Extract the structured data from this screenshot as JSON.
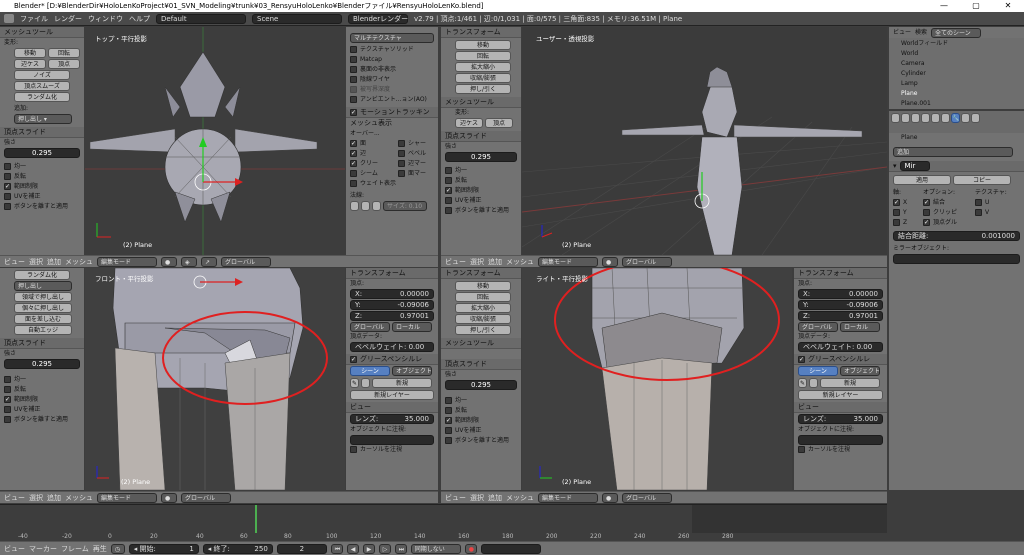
{
  "window": {
    "title": "Blender* [D:¥BlenderDir¥HoloLenKoProject¥01_SVN_Modeling¥trunk¥03_RensyuHoloLenko¥Blenderファイル¥RensyuHoloLenKo.blend]",
    "controls": [
      "—",
      "▢",
      "✕"
    ]
  },
  "infobar": {
    "menus": [
      "ファイル",
      "レンダー",
      "ウィンドウ",
      "ヘルプ"
    ],
    "layout": "Default",
    "scene": "Scene",
    "engine": "Blenderレンダー",
    "stats": "v2.79 | 頂点:1/461 | 辺:0/1,031 | 面:0/575 | 三角面:835 | メモリ:36.51M | Plane"
  },
  "left_tools_top": {
    "section": "メッシュツール",
    "deform": "変形:",
    "buttons": [
      "移動",
      "回転",
      "辺ケス",
      "頂点",
      "ノイズ",
      "頂点スムーズ",
      "ランダム化"
    ],
    "add": "追加:",
    "extrude": "押し出し ▾",
    "slide_header": "頂点スライド",
    "amount_label": "強さ",
    "amount": "0.295",
    "checks": [
      "均一",
      "反転",
      "範囲制限",
      "UVを補正",
      "ボタンを離すと適用"
    ]
  },
  "left_tools_bottom": {
    "buttons": [
      "ランダム化",
      "押し出し",
      "領域で押し出し",
      "個々に押し出し",
      "面を差し込む",
      "自動エッジ"
    ],
    "slide_header": "頂点スライド",
    "amount_label": "強さ",
    "amount": "0.295",
    "checks": [
      "均一",
      "反転",
      "範囲制限",
      "UVを補正",
      "ボタンを離すと適用"
    ]
  },
  "vp_top": {
    "title": "トップ・平行投影",
    "obj": "(2) Plane"
  },
  "vp_user": {
    "title": "ユーザー・透視投影",
    "obj": "(2) Plane"
  },
  "vp_front": {
    "title": "フロント・平行投影",
    "obj": "(2) Plane"
  },
  "vp_right": {
    "title": "ライト・平行投影",
    "obj": "(2) Plane"
  },
  "shading_panel": {
    "matcap_header": "マルチテクスチャ",
    "items": [
      "テクスチャソリッド",
      "Matcap",
      "裏面の非表示",
      "陰線ワイヤ",
      "被写界深度",
      "アンビエント...ョン(AO)"
    ],
    "motion_header": "モーショントラッキン",
    "mesh_display": "メッシュ表示",
    "overlay": "オーバー...",
    "col1": [
      "面",
      "辺",
      "クリー",
      "シーム",
      "ウェイト表示"
    ],
    "col2": [
      "シャー",
      "ベベル",
      "辺マー",
      "面マー"
    ],
    "normals": "法線:",
    "size": "サイズ: 0.10"
  },
  "tool_panel_mid": {
    "transform": "トランスフォーム",
    "buttons": [
      "移動",
      "回転",
      "拡大縮小",
      "収縮/膨張",
      "押し/引く"
    ],
    "mesh_tools": "メッシュツール",
    "deform": "変形:",
    "row": [
      "辺ケス",
      "頂点"
    ],
    "slide": "頂点スライド",
    "amount_label": "強さ",
    "amount": "0.295",
    "checks": [
      "均一",
      "反転",
      "範囲制限",
      "UVを補正",
      "ボタンを離すと適用"
    ]
  },
  "ui_panel": {
    "transform": "トランスフォーム",
    "vertex": "頂点:",
    "x": "X:",
    "xv": "0.00000",
    "y": "Y:",
    "yv": "-0.09006",
    "z": "Z:",
    "zv": "0.97001",
    "global": "グローバル",
    "local": "ローカル",
    "vertex_data": "頂点データ:",
    "bevel": "ベベルウェイト: 0.00",
    "grease": "グリースペンシルレ",
    "scene": "シーン",
    "object": "オブジェクト",
    "new": "新規",
    "new_layer": "新規レイヤー",
    "view": "ビュー",
    "lens": "レンズ:",
    "lens_v": "35.000",
    "lock": "オブジェクトに注視:",
    "cursor": "カーソルを注視"
  },
  "outliner": {
    "header": [
      "ビュー",
      "検索",
      "全てのシーン"
    ],
    "items": [
      "Worldフィールド",
      "World",
      "Camera",
      "Cylinder",
      "Lamp",
      "Plane",
      "Plane.001"
    ]
  },
  "props": {
    "object": "Plane",
    "add": "追加",
    "apply": "適用",
    "copy": "コピー",
    "axis": "軸:",
    "options": "オプション:",
    "texture": "テクスチャ:",
    "x": "X",
    "y": "Y",
    "z": "Z",
    "merge": "結合",
    "clip": "クリッピ",
    "vgroup": "頂点グル",
    "u": "U",
    "v": "V",
    "merge_dist": "結合距離:",
    "merge_val": "0.001000",
    "mirror_obj": "ミラーオブジェクト:",
    "mirror": "Mir"
  },
  "vp_bar": {
    "view": "ビュー",
    "select": "選択",
    "add": "追加",
    "mesh": "メッシュ",
    "mode": "編集モード",
    "orient": "グローバル"
  },
  "timeline": {
    "ticks": [
      "-40",
      "-20",
      "0",
      "20",
      "40",
      "60",
      "80",
      "100",
      "120",
      "140",
      "160",
      "180",
      "200",
      "220",
      "240",
      "260",
      "280"
    ],
    "menus": [
      "ビュー",
      "マーカー",
      "フレーム",
      "再生"
    ],
    "start": "◂ 開始:",
    "start_v": "1",
    "end": "◂ 終了:",
    "end_v": "250",
    "cur": "2",
    "sync": "同期しない"
  }
}
